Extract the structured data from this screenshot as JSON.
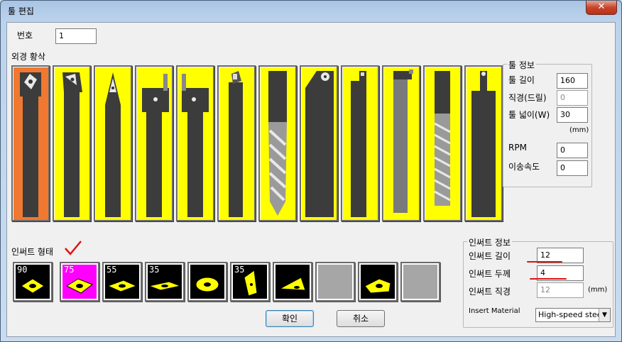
{
  "window": {
    "title": "툴 편집",
    "close_glyph": "✕"
  },
  "number": {
    "label": "번호",
    "value": "1"
  },
  "tool_section": {
    "label": "외경 황삭",
    "tools": [
      {
        "name": "tool-1",
        "selected": true
      },
      {
        "name": "tool-2"
      },
      {
        "name": "tool-3"
      },
      {
        "name": "tool-4"
      },
      {
        "name": "tool-5"
      },
      {
        "name": "tool-6"
      },
      {
        "name": "tool-7"
      },
      {
        "name": "tool-8"
      },
      {
        "name": "tool-9"
      },
      {
        "name": "tool-10"
      },
      {
        "name": "tool-11"
      },
      {
        "name": "tool-12"
      }
    ]
  },
  "tool_info": {
    "title": "툴 정보",
    "length_label": "툴 길이",
    "length_value": "160",
    "diameter_label": "직경(드릴)",
    "diameter_value": "0",
    "width_label": "툴 넓이(W)",
    "width_value": "30",
    "unit": "(mm)",
    "rpm_label": "RPM",
    "rpm_value": "0",
    "feed_label": "이송속도",
    "feed_value": "0"
  },
  "insert_section": {
    "label": "인써트 형태",
    "inserts": [
      {
        "angle": "90"
      },
      {
        "angle": "75",
        "selected": true
      },
      {
        "angle": "55"
      },
      {
        "angle": "35"
      },
      {
        "angle": ""
      },
      {
        "angle": "35"
      },
      {
        "angle": ""
      },
      {
        "angle": ""
      },
      {
        "angle": ""
      },
      {
        "angle": ""
      }
    ]
  },
  "insert_info": {
    "title": "인써트 정보",
    "length_label": "인써트 길이",
    "length_value": "12",
    "thickness_label": "인써트 두께",
    "thickness_value": "4",
    "diameter_label": "인써트 직경",
    "diameter_value": "12",
    "unit": "(mm)",
    "material_label": "Insert Material",
    "material_value": "High-speed steel"
  },
  "buttons": {
    "ok": "확인",
    "cancel": "취소"
  },
  "colors": {
    "tool_bg": "#ffff00",
    "tool_selected": "#f07830",
    "insert_selected": "#ff00ff",
    "annotation": "#e01010"
  }
}
